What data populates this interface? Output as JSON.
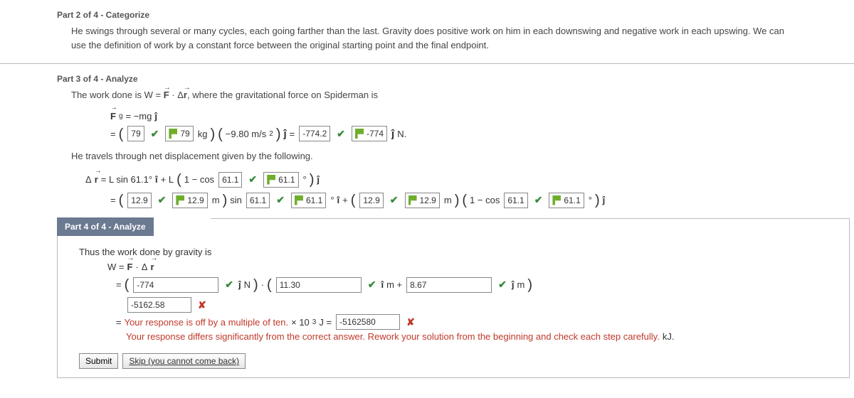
{
  "part2": {
    "header": "Part 2 of 4 - Categorize",
    "text": "He swings through several or many cycles, each going farther than the last. Gravity does positive work on him in each downswing and negative work in each upswing. We can use the definition of work by a constant force between the original starting point and the final endpoint."
  },
  "part3": {
    "header": "Part 3 of 4 - Analyze",
    "intro": "The work done is W = ",
    "intro2": ", where the gravitational force on Spiderman is",
    "fg_label": "F",
    "fg_sub": "g",
    "eq_mg": " = −mg",
    "mass1": "79",
    "mass2": "79",
    "kg": " kg",
    "g_accel": "−9.80 m/s",
    "sq": "2",
    "eq1_result": "-774.2",
    "eq1_result2": "-774",
    "n_unit": " N.",
    "travels": "He travels through net displacement given by the following.",
    "dr_eq": " = L sin 61.1° ",
    "plus_L": " + L",
    "one_minus_cos": "1 − cos",
    "ang1": "61.1",
    "ang2": "61.1",
    "deg": " °",
    "len1": "12.9",
    "len2": "12.9",
    "m_sin": " m",
    "sin_txt": "sin ",
    "ang3": "61.1",
    "ang4": "61.1",
    "deg_i": " °",
    "plus": " + ",
    "len3": "12.9",
    "len4": "12.9",
    "m_txt": " m",
    "one_minus_cos2": "1 − cos ",
    "ang5": "61.1",
    "ang6": "61.1"
  },
  "part4": {
    "header": "Part 4 of 4 - Analyze",
    "intro": "Thus the work done by gravity is",
    "w_eq": "W = ",
    "dot": " · ",
    "val_j": "-774",
    "j_n": " N",
    "val_i": "11.30",
    "i_m_plus": " m + ",
    "val_im": "8.67",
    "j_m": " m",
    "bad_val": "-5162.58",
    "feedback1": "Your response is off by a multiple of ten.",
    "times_ten": " × 10",
    "cube": "3",
    "j_eq": " J = ",
    "bad_val2": "-5162580",
    "feedback2": "Your response differs significantly from the correct answer. Rework your solution from the beginning and check each step carefully.",
    "kj": " kJ.",
    "submit": "Submit",
    "skip": "Skip (you cannot come back)"
  }
}
